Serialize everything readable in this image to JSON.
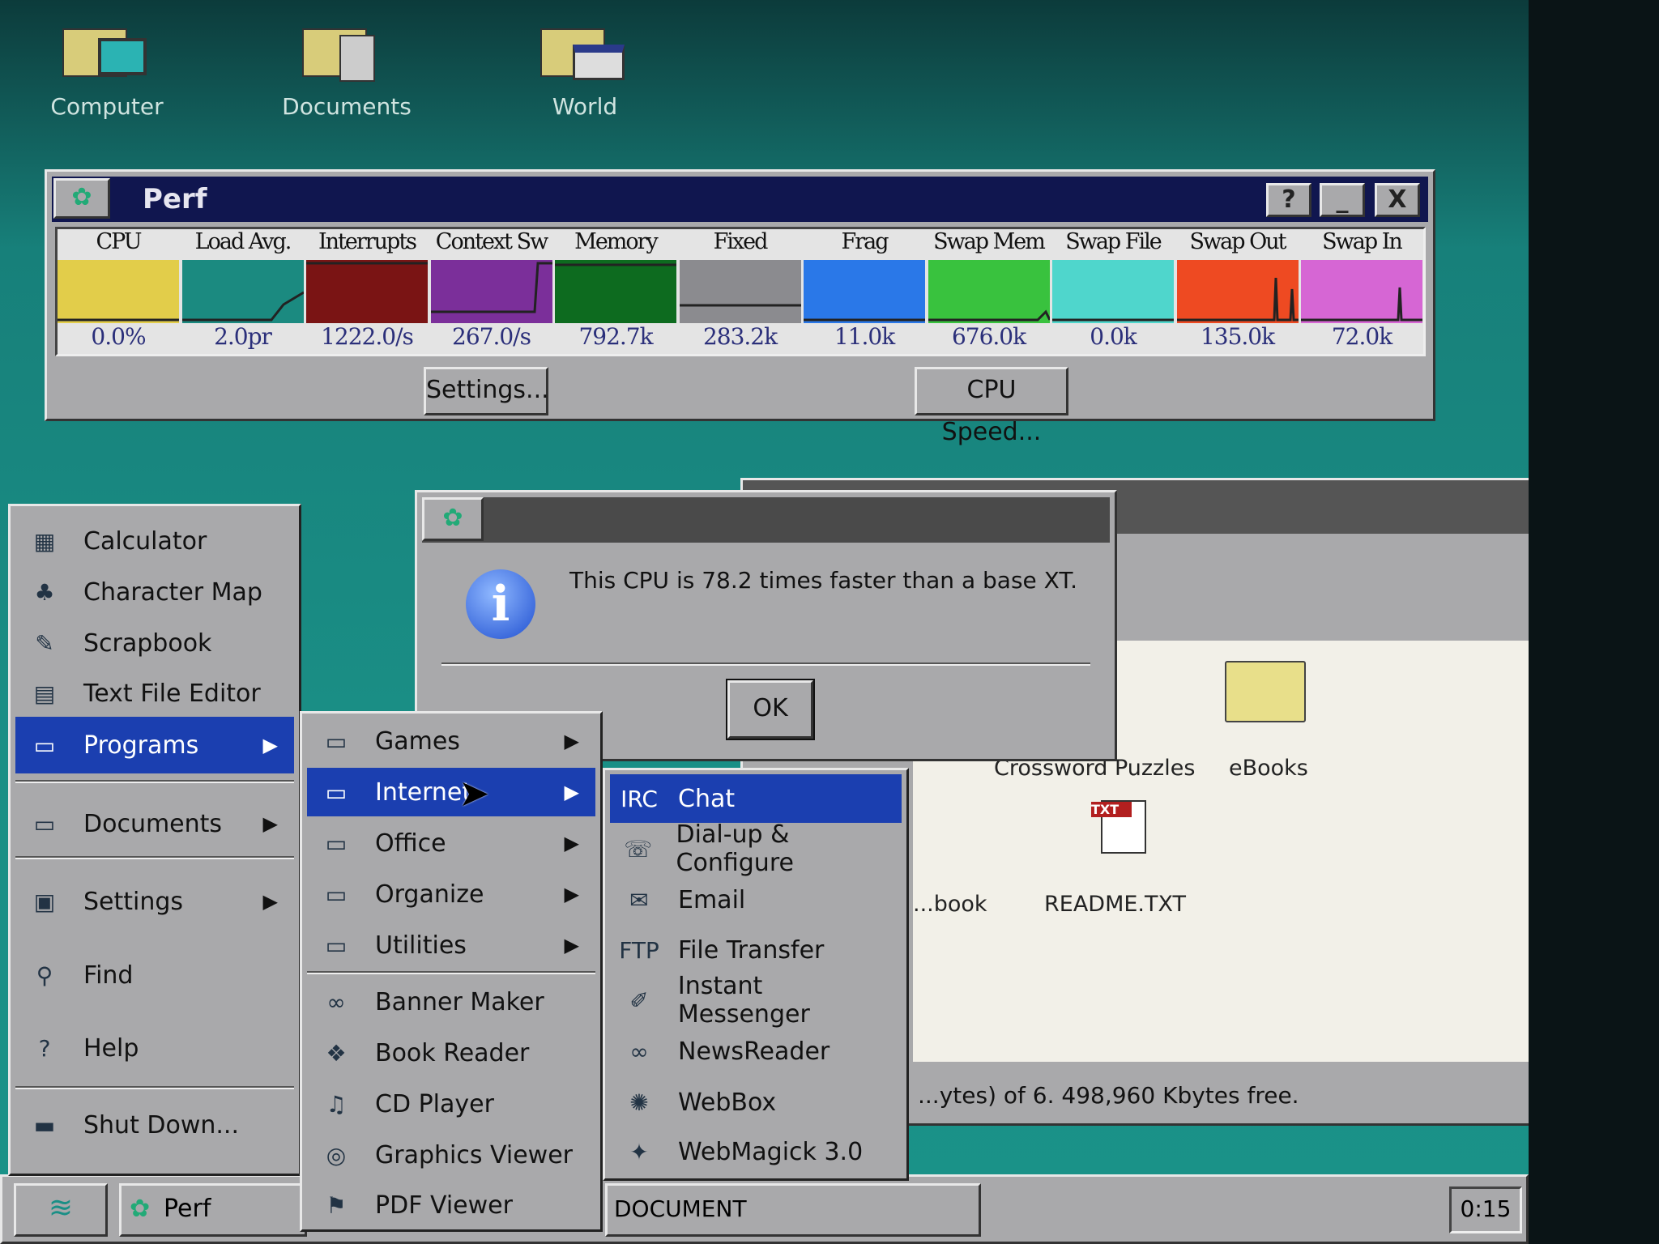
{
  "desktop": {
    "icons": [
      {
        "label": "Computer",
        "icon": "computer-icon"
      },
      {
        "label": "Documents",
        "icon": "documents-icon"
      },
      {
        "label": "World",
        "icon": "world-icon"
      }
    ]
  },
  "perf": {
    "title": "Perf",
    "help": "?",
    "minimize": "_",
    "close": "X",
    "meters": [
      {
        "label": "CPU",
        "value": "0.0%",
        "color": "#e2cd4a"
      },
      {
        "label": "Load Avg.",
        "value": "2.0pr",
        "color": "#1b8a80"
      },
      {
        "label": "Interrupts",
        "value": "1222.0/s",
        "color": "#7a1414"
      },
      {
        "label": "Context Sw",
        "value": "267.0/s",
        "color": "#7b2f9a"
      },
      {
        "label": "Memory",
        "value": "792.7k",
        "color": "#0d6b1f"
      },
      {
        "label": "Fixed",
        "value": "283.2k",
        "color": "#8b8b8f"
      },
      {
        "label": "Frag",
        "value": "11.0k",
        "color": "#2a78e8"
      },
      {
        "label": "Swap Mem",
        "value": "676.0k",
        "color": "#39c23e"
      },
      {
        "label": "Swap File",
        "value": "0.0k",
        "color": "#4fd6cc"
      },
      {
        "label": "Swap Out",
        "value": "135.0k",
        "color": "#ee4a22"
      },
      {
        "label": "Swap In",
        "value": "72.0k",
        "color": "#d666d4"
      }
    ],
    "settings_label": "Settings...",
    "cpu_speed_label": "CPU Speed..."
  },
  "dialog": {
    "message": "This CPU is 78.2 times faster than a base XT.",
    "ok_label": "OK"
  },
  "folder_window": {
    "items": [
      "Crossword Puzzles",
      "eBooks",
      "...book",
      "README.TXT"
    ],
    "status": "...ytes) of 6.  498,960 Kbytes free."
  },
  "start_menu": {
    "items": [
      {
        "label": "Calculator",
        "icon": "calculator-icon",
        "glyph": "▦"
      },
      {
        "label": "Character Map",
        "icon": "character-map-icon",
        "glyph": "♣"
      },
      {
        "label": "Scrapbook",
        "icon": "scrapbook-icon",
        "glyph": "✎"
      },
      {
        "label": "Text File Editor",
        "icon": "text-editor-icon",
        "glyph": "▤"
      },
      {
        "label": "Programs",
        "icon": "programs-folder-icon",
        "glyph": "▭",
        "submenu": true,
        "selected": true
      },
      {
        "label": "Documents",
        "icon": "documents-folder-icon",
        "glyph": "▭",
        "submenu": true
      },
      {
        "label": "Settings",
        "icon": "settings-icon",
        "glyph": "▣",
        "submenu": true
      },
      {
        "label": "Find",
        "icon": "find-icon",
        "glyph": "⚲"
      },
      {
        "label": "Help",
        "icon": "help-icon",
        "glyph": "?"
      },
      {
        "label": "Shut Down...",
        "icon": "shutdown-icon",
        "glyph": "▬"
      }
    ]
  },
  "programs_menu": {
    "items": [
      {
        "label": "Games",
        "icon": "folder-icon",
        "glyph": "▭",
        "submenu": true
      },
      {
        "label": "Internet",
        "icon": "folder-icon",
        "glyph": "▭",
        "submenu": true,
        "selected": true
      },
      {
        "label": "Office",
        "icon": "folder-icon",
        "glyph": "▭",
        "submenu": true
      },
      {
        "label": "Organize",
        "icon": "folder-icon",
        "glyph": "▭",
        "submenu": true
      },
      {
        "label": "Utilities",
        "icon": "folder-icon",
        "glyph": "▭",
        "submenu": true
      },
      {
        "label": "Banner Maker",
        "icon": "banner-maker-icon",
        "glyph": "∞"
      },
      {
        "label": "Book Reader",
        "icon": "book-reader-icon",
        "glyph": "❖"
      },
      {
        "label": "CD Player",
        "icon": "cd-player-icon",
        "glyph": "♫"
      },
      {
        "label": "Graphics Viewer",
        "icon": "graphics-viewer-icon",
        "glyph": "◎"
      },
      {
        "label": "PDF Viewer",
        "icon": "pdf-viewer-icon",
        "glyph": "⚑"
      }
    ]
  },
  "internet_menu": {
    "items": [
      {
        "label": "Chat",
        "icon": "irc-icon",
        "glyph": "IRC",
        "selected": true
      },
      {
        "label": "Dial-up & Configure",
        "icon": "dialup-icon",
        "glyph": "☏"
      },
      {
        "label": "Email",
        "icon": "email-icon",
        "glyph": "✉"
      },
      {
        "label": "File Transfer",
        "icon": "ftp-icon",
        "glyph": "FTP"
      },
      {
        "label": "Instant Messenger",
        "icon": "messenger-icon",
        "glyph": "✐"
      },
      {
        "label": "NewsReader",
        "icon": "newsreader-icon",
        "glyph": "∞"
      },
      {
        "label": "WebBox",
        "icon": "webbox-icon",
        "glyph": "✺"
      },
      {
        "label": "WebMagick 3.0",
        "icon": "webmagick-icon",
        "glyph": "✦"
      }
    ]
  },
  "taskbar": {
    "tasks": [
      "Perf",
      "DOCUMENT"
    ],
    "clock": "0:15"
  }
}
